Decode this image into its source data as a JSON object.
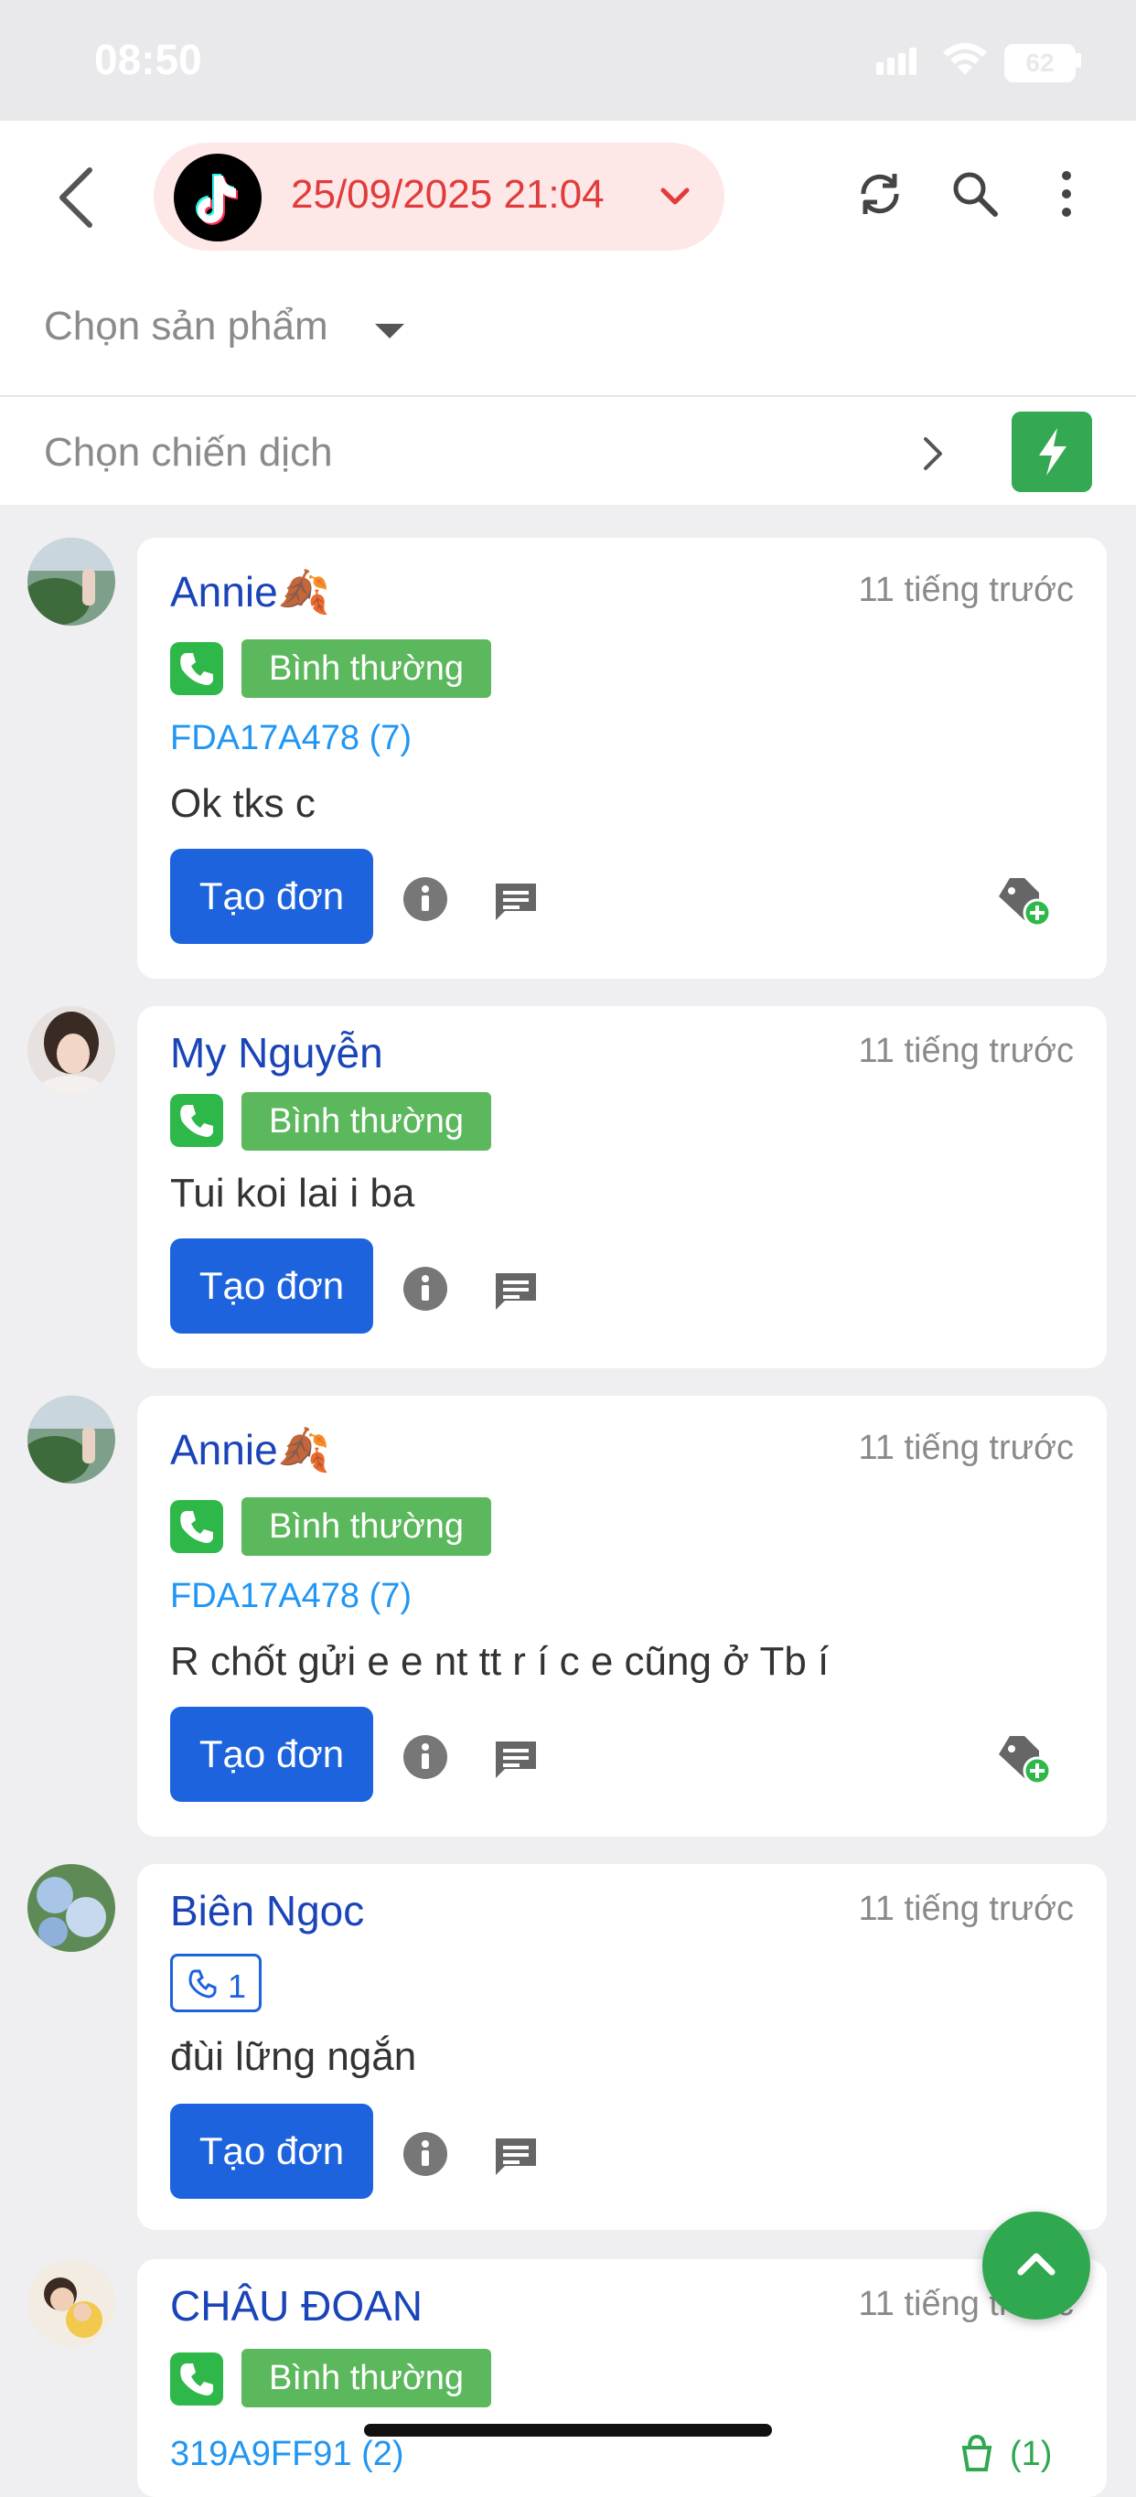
{
  "status": {
    "time": "08:50",
    "battery": "62"
  },
  "header": {
    "datetime": "25/09/2025 21:04",
    "product_placeholder": "Chọn sản phẩm",
    "campaign_placeholder": "Chọn chiến dịch"
  },
  "colors": {
    "accent": "#1c63dd",
    "danger": "#e23b3b",
    "success": "#2fb84a",
    "name": "#1a44b8",
    "link": "#2196f3"
  },
  "cards": [
    {
      "name": "Annie🍂",
      "ago": "11 tiếng trước",
      "status": "Bình thường",
      "code": "FDA17A478 (7)",
      "message": "Ok tks c",
      "action": "Tạo đơn"
    },
    {
      "name": "My Nguyễn",
      "ago": "11 tiếng trước",
      "status": "Bình thường",
      "message": "Tui koi lai i ba",
      "action": "Tạo đơn"
    },
    {
      "name": "Annie🍂",
      "ago": "11 tiếng trước",
      "status": "Bình thường",
      "code": "FDA17A478 (7)",
      "message": "R chốt gửi e e nt tt r í c e cũng ở Tb í",
      "action": "Tạo đơn"
    },
    {
      "name": "Biên Ngoc",
      "ago": "11 tiếng trước",
      "call_count": "1",
      "message": "đùi lững ngắn",
      "action": "Tạo đơn"
    },
    {
      "name": "CHÂU ĐOAN",
      "ago": "11 tiếng trước",
      "status": "Bình thường",
      "code": "319A9FF91 (2)",
      "cart_count": "(1)"
    }
  ]
}
